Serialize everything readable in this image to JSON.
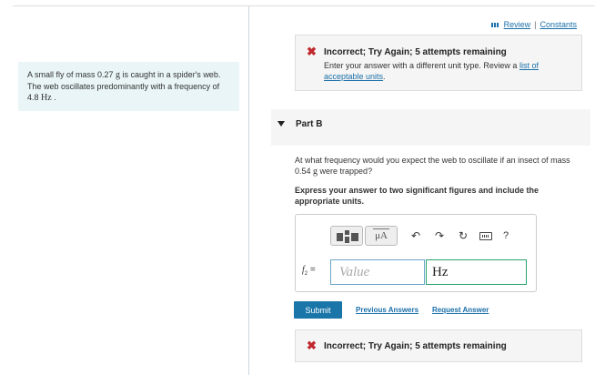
{
  "header": {
    "review_label": "Review",
    "separator": "|",
    "constants_label": "Constants"
  },
  "problem": {
    "text_before_mass": "A small fly of mass 0.27 ",
    "mass_unit": "g",
    "text_after_mass": " is caught in a spider's web. The web oscillates predominantly with a frequency of 4.8 ",
    "freq_unit": "Hz",
    "text_end": " ."
  },
  "feedback_top": {
    "icon": "✖",
    "title": "Incorrect; Try Again; 5 attempts remaining",
    "message_before_link": "Enter your answer with a different unit type. Review a ",
    "link_text": "list of acceptable units",
    "message_after_link": "."
  },
  "part": {
    "label": "Part B"
  },
  "question": {
    "text_before": "At what frequency would you expect the web to oscillate if an insect of mass 0.54 ",
    "unit": "g",
    "text_after": " were trapped?"
  },
  "instruction": "Express your answer to two significant figures and include the appropriate units.",
  "toolbar": {
    "units_button_label": "μA",
    "undo_icon": "↶",
    "redo_icon": "↷",
    "reset_icon": "↻",
    "help_label": "?"
  },
  "answer": {
    "variable": "f",
    "subscript": "2",
    "equals": " =",
    "value_placeholder": "Value",
    "unit_value": "Hz"
  },
  "actions": {
    "submit_label": "Submit",
    "previous_answers_label": "Previous Answers",
    "request_answer_label": "Request Answer"
  },
  "feedback_bottom": {
    "icon": "✖",
    "title": "Incorrect; Try Again; 5 attempts remaining"
  },
  "colors": {
    "link": "#1a6fa8",
    "error": "#c0282d",
    "submit_bg": "#1a76a8",
    "unit_border": "#2aa36d",
    "problem_bg": "#e9f5f7"
  }
}
